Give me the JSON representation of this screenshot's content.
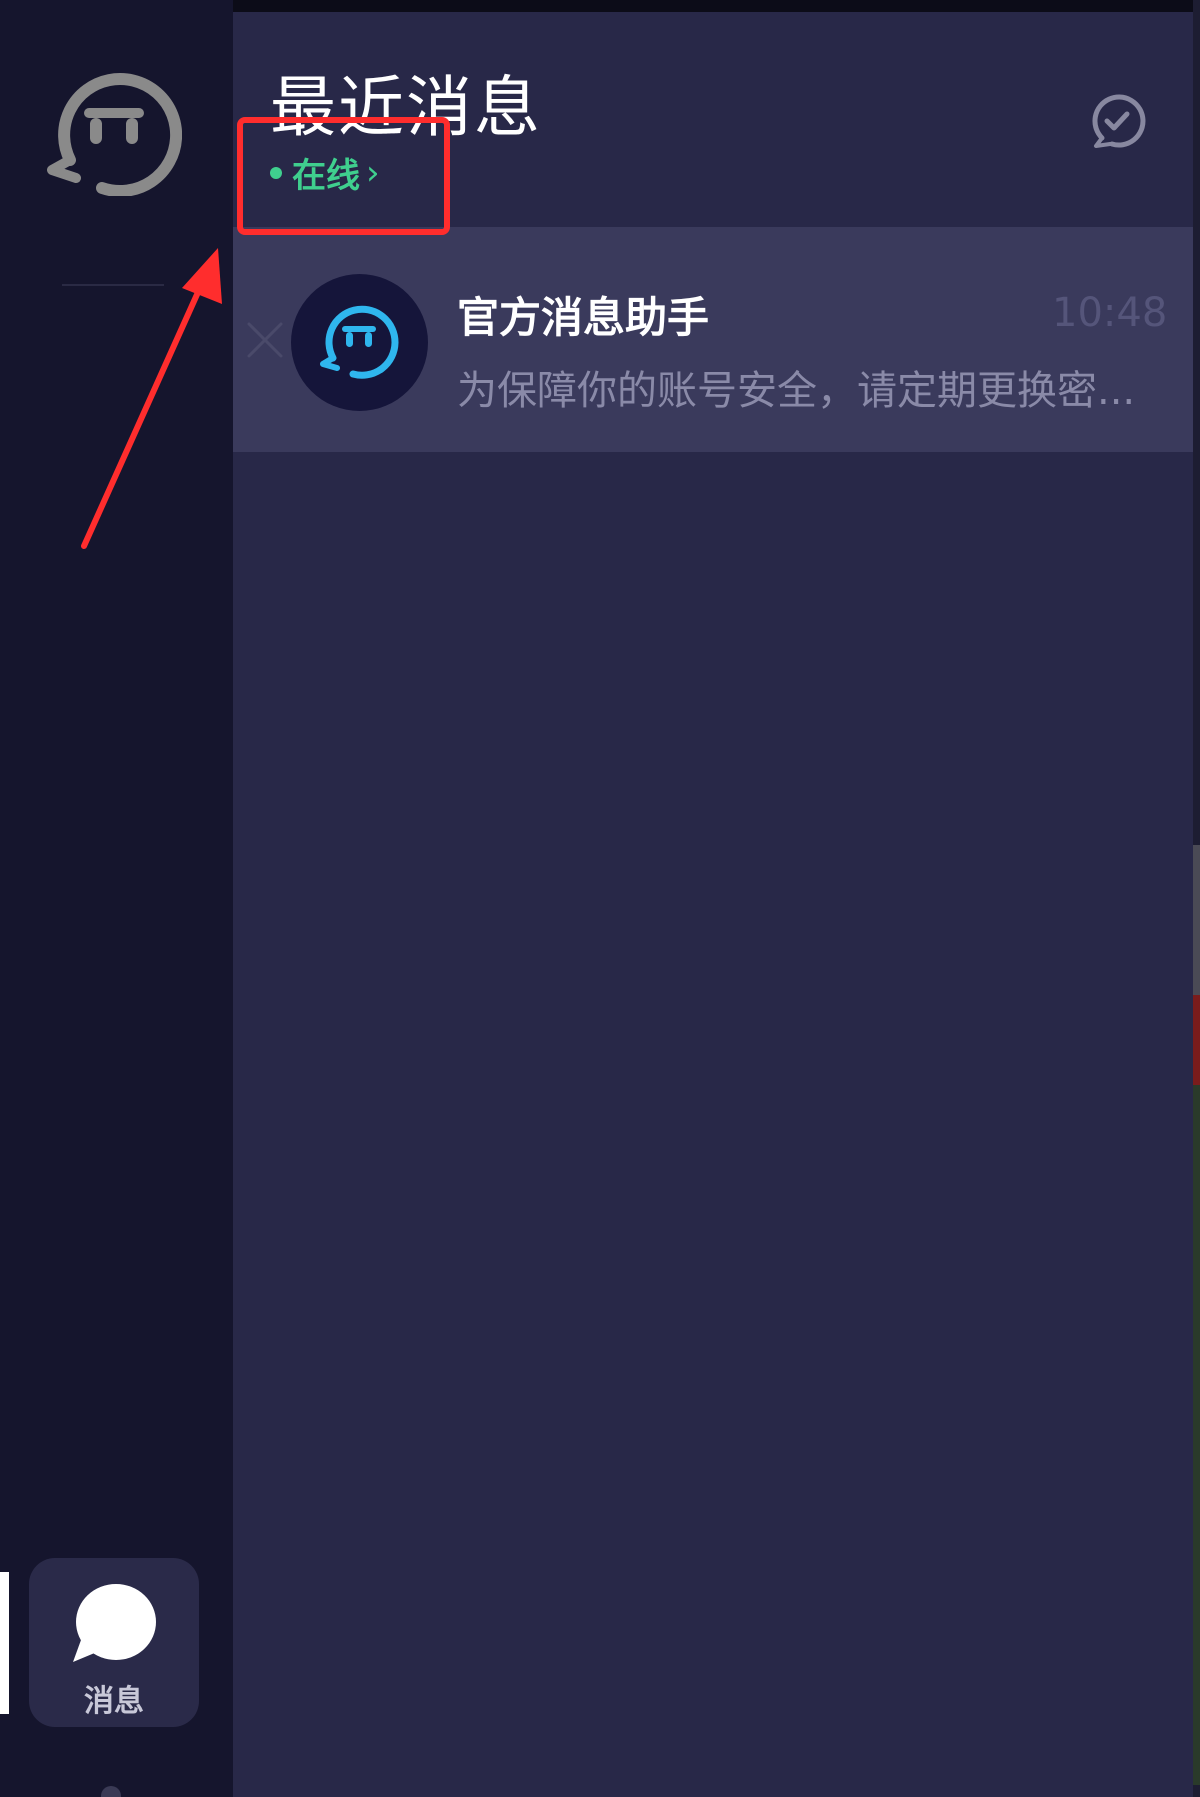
{
  "sidebar": {
    "logo_icon": "robot-face-chat-icon",
    "nav": [
      {
        "label": "消息",
        "icon": "chat-bubble-icon",
        "active": true
      }
    ]
  },
  "panel": {
    "title": "最近消息",
    "status": {
      "label": "在线",
      "chevron": "›",
      "color": "#3fcf8e"
    },
    "action_icon": "check-bubble-icon"
  },
  "conversations": [
    {
      "name": "官方消息助手",
      "time": "10:48",
      "preview": "为保障你的账号安全，请定期更换密...",
      "avatar_icon": "robot-face-chat-icon",
      "close_icon": "close-icon"
    }
  ],
  "annotations": {
    "highlight_color": "#ff2d2d",
    "arrow_color": "#ff2d2d"
  }
}
